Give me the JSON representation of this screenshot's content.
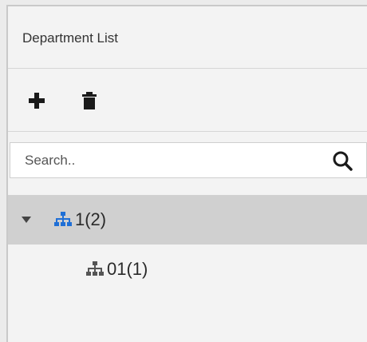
{
  "panel": {
    "title": "Department List"
  },
  "toolbar": {
    "add_icon": "plus-icon",
    "delete_icon": "trash-icon"
  },
  "search": {
    "placeholder": "Search..",
    "icon": "search-icon"
  },
  "tree": {
    "nodes": [
      {
        "label": "1(2)",
        "level": 0,
        "expanded": true,
        "selected": true,
        "icon": "org-chart-icon"
      },
      {
        "label": "01(1)",
        "level": 1,
        "expanded": false,
        "selected": false,
        "icon": "org-chart-icon"
      }
    ]
  },
  "colors": {
    "icon_blue": "#1f6fd6",
    "icon_gray": "#555555",
    "selected_row": "#d0d0d0",
    "background": "#f3f3f3"
  }
}
